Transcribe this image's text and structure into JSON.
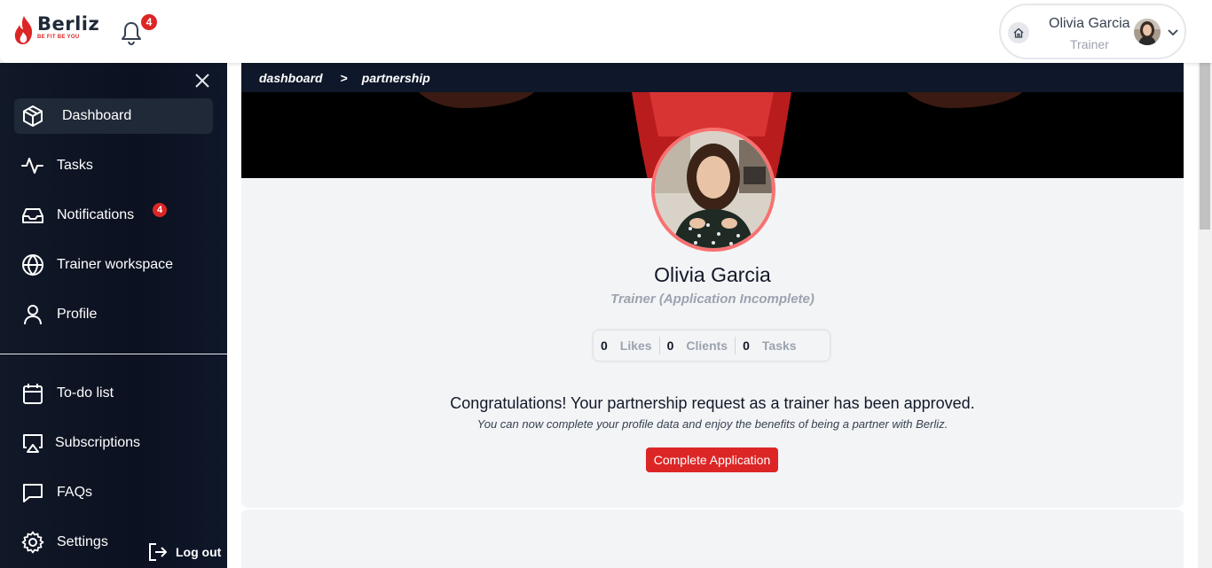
{
  "header": {
    "logo_name": "Berliz",
    "logo_tagline": "BE FIT BE YOU",
    "notification_count": "4",
    "user_name": "Olivia Garcia",
    "user_role": "Trainer"
  },
  "sidebar": {
    "items": [
      {
        "label": "Dashboard",
        "icon": "cube-icon",
        "active": true
      },
      {
        "label": "Tasks",
        "icon": "activity-icon"
      },
      {
        "label": "Notifications",
        "icon": "inbox-icon",
        "badge": "4"
      },
      {
        "label": "Trainer workspace",
        "icon": "globe-icon"
      },
      {
        "label": "Profile",
        "icon": "user-icon"
      }
    ],
    "items_bottom": [
      {
        "label": "To-do list",
        "icon": "calendar-icon"
      },
      {
        "label": "Subscriptions",
        "icon": "airplay-icon"
      },
      {
        "label": "FAQs",
        "icon": "message-square-icon"
      },
      {
        "label": "Settings",
        "icon": "gear-icon"
      }
    ],
    "logout_label": "Log out"
  },
  "breadcrumb": {
    "items": [
      "dashboard",
      "partnership"
    ],
    "separator": ">"
  },
  "profile": {
    "name": "Olivia Garcia",
    "subtitle": "Trainer (Application Incomplete)",
    "stats": [
      {
        "value": "0",
        "label": "Likes"
      },
      {
        "value": "0",
        "label": "Clients"
      },
      {
        "value": "0",
        "label": "Tasks"
      }
    ]
  },
  "message": {
    "title": "Congratulations! Your partnership request as a trainer has been approved.",
    "subtitle": "You can now complete your profile data and enjoy the benefits of being a partner with Berliz.",
    "cta_label": "Complete Application"
  },
  "colors": {
    "accent": "#dc2626",
    "sidebar_bg": "#0b1120",
    "card_bg": "#f3f4f6",
    "avatar_ring": "#f87171"
  }
}
